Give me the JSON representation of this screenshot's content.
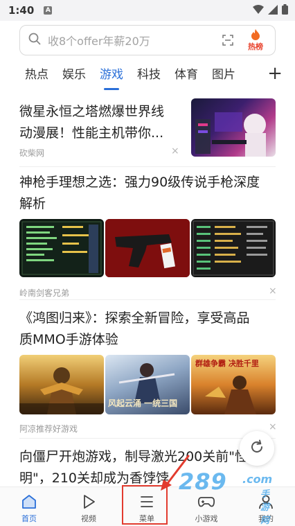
{
  "status_bar": {
    "time": "1:40",
    "notification_badge": "A",
    "icons": [
      "wifi-icon",
      "signal-icon",
      "battery-icon"
    ]
  },
  "search": {
    "placeholder": "收8个offer年薪20万",
    "hot_label": "热榜",
    "icon": "search-icon"
  },
  "tabs": [
    {
      "label": "热点",
      "active": false
    },
    {
      "label": "娱乐",
      "active": false
    },
    {
      "label": "游戏",
      "active": true
    },
    {
      "label": "科技",
      "active": false
    },
    {
      "label": "体育",
      "active": false
    },
    {
      "label": "图片",
      "active": false
    }
  ],
  "tab_add": "+",
  "articles": [
    {
      "title_line1": "微星永恒之塔燃爆世界线",
      "title_line2": "动漫展！性能主机带你...",
      "source": "砍柴网",
      "close": "×"
    },
    {
      "title_line1": "神枪手理想之选：强力90级传说手枪深度",
      "title_line2": "解析",
      "source": "岭南剑客兄弟",
      "close": "×"
    },
    {
      "title_line1": "《鸿图归来》：探索全新冒险，享受高品",
      "title_line2": "质MMO手游体验",
      "source": "阿凉推荐好游戏",
      "close": "×"
    },
    {
      "title_line1": "向僵尸开炮游戏，制导激光200关前\"怪",
      "title_line2": "明\"，210关却成为香饽饽"
    }
  ],
  "image_captions": {
    "game_art_2": "风起云涌 一统三国",
    "game_art_3": "群雄争霸 决胜千里"
  },
  "watermark": {
    "number": "289",
    "suffix": ".com",
    "subtitle": "手游网"
  },
  "bottom_nav": [
    {
      "label": "首页",
      "icon": "home-icon",
      "active": true
    },
    {
      "label": "视频",
      "icon": "play-icon",
      "active": false
    },
    {
      "label": "菜单",
      "icon": "menu-icon",
      "active": false
    },
    {
      "label": "小游戏",
      "icon": "gamepad-icon",
      "active": false
    },
    {
      "label": "我的",
      "icon": "user-icon",
      "active": false
    }
  ],
  "colors": {
    "accent": "#2a6fd8",
    "hot": "#e8432e",
    "annotation": "#e23b2e"
  }
}
